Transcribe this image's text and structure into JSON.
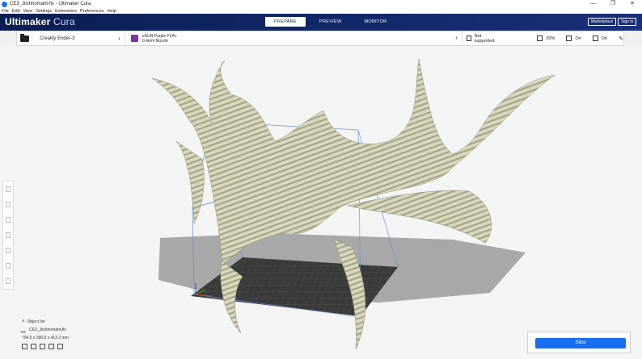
{
  "window": {
    "title": "CE3_Jiishhomaht-fix - Ultimaker Cura",
    "controls": [
      "—",
      "❐",
      "✕"
    ]
  },
  "menu": [
    "File",
    "Edit",
    "View",
    "Settings",
    "Extensions",
    "Preferences",
    "Help"
  ],
  "header": {
    "logo_bold": "Ultimaker",
    "logo_thin": "Cura",
    "tabs": [
      {
        "label": "PREPARE",
        "active": true
      },
      {
        "label": "PREVIEW",
        "active": false
      },
      {
        "label": "MONITOR",
        "active": false
      }
    ],
    "marketplace": "Marketplace",
    "signin": "Sign in"
  },
  "toolbar": {
    "printer": "Creality Ender-3",
    "material_line1": "eSUN Purple PLA+",
    "material_line2": "0.4mm Nozzle",
    "support": "Not supported",
    "infill": "20%",
    "adhesion": "On",
    "support_toggle": "On",
    "icons": {
      "open": "folder-icon",
      "material": "spool-icon",
      "support": "support-icon",
      "infill": "infill-icon",
      "adhesion": "adhesion-icon",
      "edit": "pencil-icon"
    }
  },
  "object_list": {
    "header": "Object list",
    "name": "CE3_Jiishhomaht-fix",
    "dimensions": "704.5 x 390.5 x 413.2 mm"
  },
  "slice": {
    "button": "Slice"
  },
  "colors": {
    "header": "#0a1e52",
    "accent": "#196ef0",
    "model": "#d4d3b4",
    "material": "#8a2ab0"
  }
}
